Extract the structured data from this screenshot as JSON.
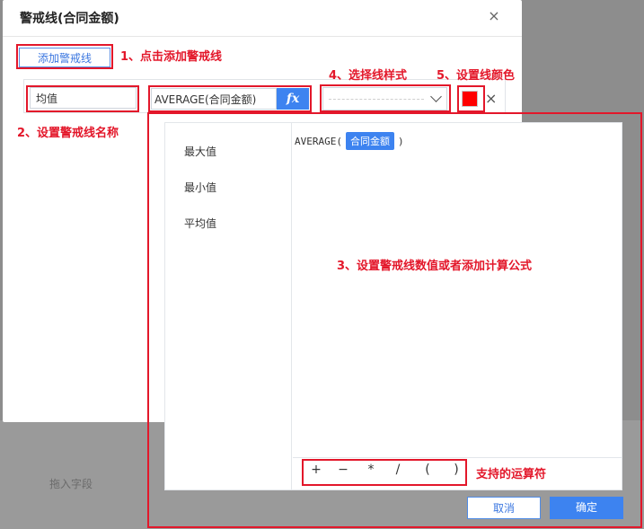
{
  "dialog": {
    "title": "警戒线(合同金额)",
    "close_icon": "×"
  },
  "add_line_button": "添加警戒线",
  "line": {
    "name_value": "均值",
    "formula_value": "AVERAGE(合同金额)",
    "fx_label": "fx",
    "color": "#ff0000",
    "remove_icon": "×"
  },
  "formula_editor": {
    "functions": [
      "最大值",
      "最小值",
      "平均值"
    ],
    "formula_prefix": "AVERAGE(",
    "formula_field": "合同金额",
    "formula_suffix": ")",
    "operators": [
      "+",
      "−",
      "*",
      "/",
      "(",
      ")"
    ]
  },
  "footer": {
    "cancel_label": "取消",
    "confirm_label": "确定"
  },
  "background": {
    "drag_field_label": "拖入字段"
  },
  "annotations": {
    "step1": "1、点击添加警戒线",
    "step2": "2、设置警戒线名称",
    "step3": "3、设置警戒线数值或者添加计算公式",
    "step4": "4、选择线样式",
    "step5": "5、设置线颜色",
    "operators_note": "支持的运算符"
  },
  "colors": {
    "accent": "#3d83f0",
    "annotation_red": "#e3172a",
    "line_color": "#ff0000"
  }
}
